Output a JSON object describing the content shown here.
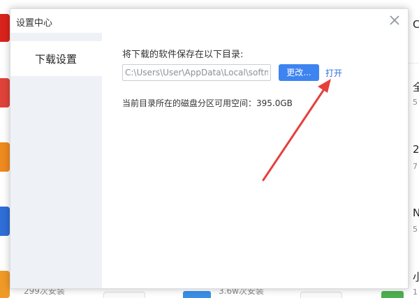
{
  "dialog": {
    "title": "设置中心",
    "close_icon": "close-icon"
  },
  "sidebar": {
    "items": [
      {
        "label": "下载设置",
        "selected": true
      }
    ]
  },
  "download_settings": {
    "save_dir_label": "将下载的软件保存在以下目录:",
    "path_value": "C:\\Users\\User\\AppData\\Local\\softmgr\\",
    "change_button": "更改...",
    "open_link": "打开",
    "space_text": "当前目录所在的磁盘分区可用空间：395.0GB"
  },
  "background": {
    "right_letters": [
      "C",
      "全",
      "5",
      "2",
      "7",
      "N",
      "5",
      "小",
      "1"
    ],
    "install_counts": [
      "299次安装",
      "3.6w次安装"
    ]
  },
  "annotation": {
    "arrow_color": "#e5403c"
  },
  "colors": {
    "accent": "#3d84f0",
    "link": "#2d6fdc",
    "sidebar_bg": "#eef1f6"
  }
}
